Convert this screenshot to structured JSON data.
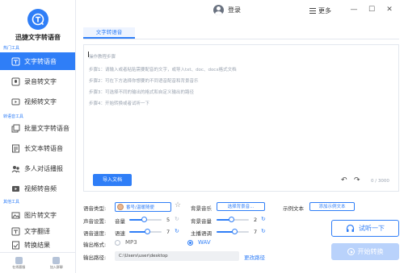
{
  "app": {
    "name": "迅捷文字转语音",
    "logo_icon": "speech-bubble-t-icon"
  },
  "sidebar": {
    "groups": [
      {
        "label": "热门工具"
      },
      {
        "label": "转语音工具"
      },
      {
        "label": "其他工具"
      }
    ],
    "items": [
      {
        "label": "文字转语音",
        "icon": "text-to-speech-icon",
        "active": true
      },
      {
        "label": "录音转文字",
        "icon": "record-icon"
      },
      {
        "label": "视频转文字",
        "icon": "video-icon"
      },
      {
        "label": "批量文字转语音",
        "icon": "batch-icon"
      },
      {
        "label": "长文本转语音",
        "icon": "long-text-icon"
      },
      {
        "label": "多人对话播报",
        "icon": "dialog-icon"
      },
      {
        "label": "视频转音频",
        "icon": "video-audio-icon"
      },
      {
        "label": "图片转文字",
        "icon": "image-icon"
      },
      {
        "label": "文字翻译",
        "icon": "translate-icon"
      },
      {
        "label": "转换结果",
        "icon": "result-icon"
      }
    ],
    "bottom": [
      {
        "label": "在线客服"
      },
      {
        "label": "加入群聊"
      }
    ]
  },
  "topbar": {
    "login_label": "登录",
    "more_label": "更多"
  },
  "window": {
    "minimize": "—",
    "maximize": "☐",
    "close": "✕"
  },
  "tab": {
    "label": "文字转语音"
  },
  "editor": {
    "lines": [
      "操作教程步骤",
      "步骤1：请输入或者粘贴需要配音的文字，或导入txt、doc、docx格式文档",
      "步骤2：可在下方选择你想要的不同语音配音和背景音乐",
      "步骤3：可选择不同的输出的格式和自定义输出的路径",
      "步骤4：开始转换或者试听一下"
    ],
    "import_label": "导入文档",
    "counter": "0 / 3000"
  },
  "settings": {
    "voice_type_label": "语音类型:",
    "voice_name": "番号/温暖随便",
    "bgm_label": "背景音乐",
    "bgm_button": "选择背景音...",
    "example_label": "示例文本",
    "example_button": "添加示例文本",
    "sound_label": "声音设置:",
    "volume_label": "音量",
    "volume_value": "5",
    "bg_volume_label": "背景音量",
    "bg_volume_value": "2",
    "speed_section_label": "语音速度:",
    "speed_label": "语速",
    "speed_value": "7",
    "pitch_label": "主播语调",
    "pitch_value": "7",
    "format_label": "输出格式:",
    "formats": [
      "MP3",
      "WAV"
    ],
    "selected_format": "WAV",
    "path_label": "输出路径:",
    "path_value": "C:\\Users\\user\\desktop",
    "change_path": "更改路径"
  },
  "actions": {
    "listen_label": "试听一下",
    "convert_label": "开始转换"
  },
  "colors": {
    "accent": "#2f7ef7",
    "disabled": "#b9d2fb"
  }
}
